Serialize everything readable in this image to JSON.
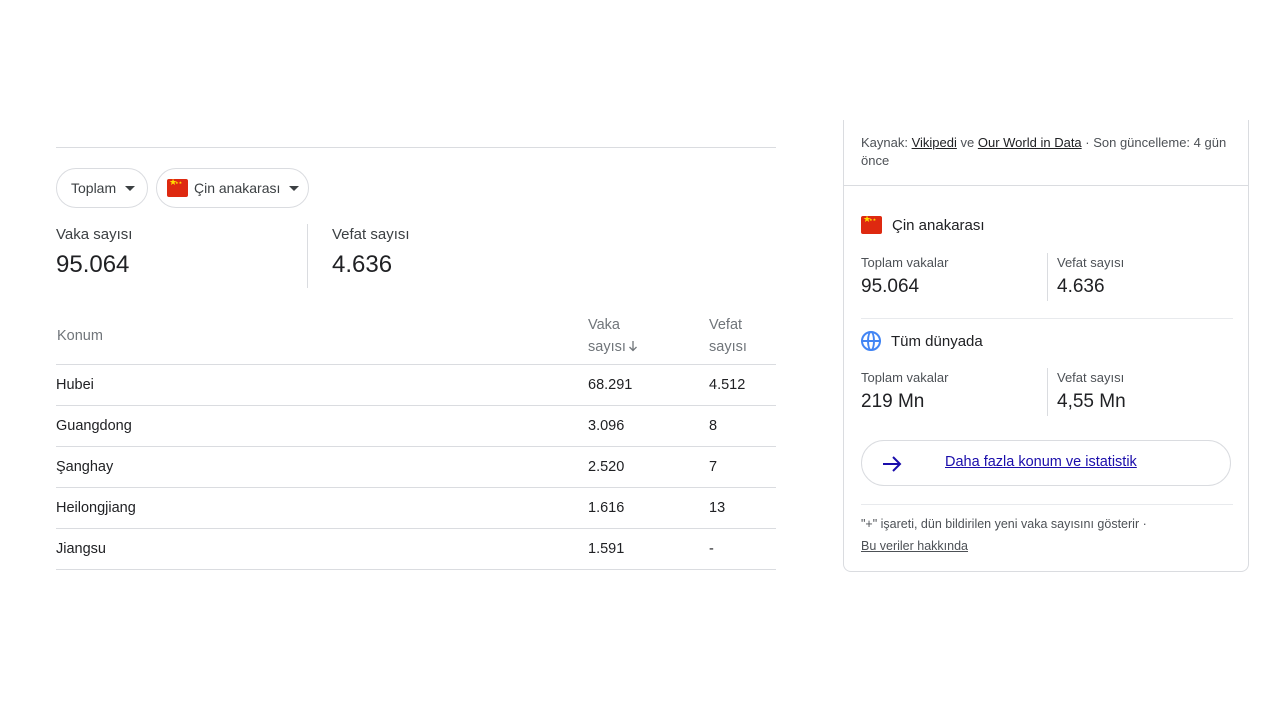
{
  "filters": {
    "total_label": "Toplam",
    "region_label": "Çin anakarası"
  },
  "summary": {
    "cases_label": "Vaka sayısı",
    "cases_value": "95.064",
    "deaths_label": "Vefat sayısı",
    "deaths_value": "4.636"
  },
  "table": {
    "headers": {
      "location": "Konum",
      "cases_line1": "Vaka",
      "cases_line2": "sayısı",
      "deaths_line1": "Vefat",
      "deaths_line2": "sayısı"
    },
    "rows": [
      {
        "location": "Hubei",
        "cases": "68.291",
        "deaths": "4.512"
      },
      {
        "location": "Guangdong",
        "cases": "3.096",
        "deaths": "8"
      },
      {
        "location": "Şanghay",
        "cases": "2.520",
        "deaths": "7"
      },
      {
        "location": "Heilongjiang",
        "cases": "1.616",
        "deaths": "13"
      },
      {
        "location": "Jiangsu",
        "cases": "1.591",
        "deaths": "-"
      }
    ]
  },
  "card": {
    "source_prefix": "Kaynak: ",
    "source_link1": "Vikipedi",
    "source_mid": " ve ",
    "source_link2": "Our World in Data",
    "source_suffix": " · Son güncelleme: 4 gün önce",
    "region": {
      "name": "Çin anakarası",
      "total_cases_label": "Toplam vakalar",
      "total_cases_value": "95.064",
      "deaths_label": "Vefat sayısı",
      "deaths_value": "4.636"
    },
    "world": {
      "name": "Tüm dünyada",
      "total_cases_label": "Toplam vakalar",
      "total_cases_value": "219 Mn",
      "deaths_label": "Vefat sayısı",
      "deaths_value": "4,55 Mn"
    },
    "more_button": "Daha fazla konum ve istatistik",
    "footnote": "\"+\" işareti, dün bildirilen yeni vaka sayısını gösterir ·",
    "about_link": "Bu veriler hakkında"
  },
  "icons": {
    "flag": "china-flag-icon",
    "globe": "globe-icon",
    "arrow": "arrow-right-icon",
    "sort": "sort-down-arrow-icon",
    "caret": "caret-down-icon"
  },
  "colors": {
    "link": "#1a0dab",
    "arrow": "#1a0dab",
    "globe": "#4285f4",
    "flag_red": "#de2910",
    "flag_star": "#ffde00"
  }
}
